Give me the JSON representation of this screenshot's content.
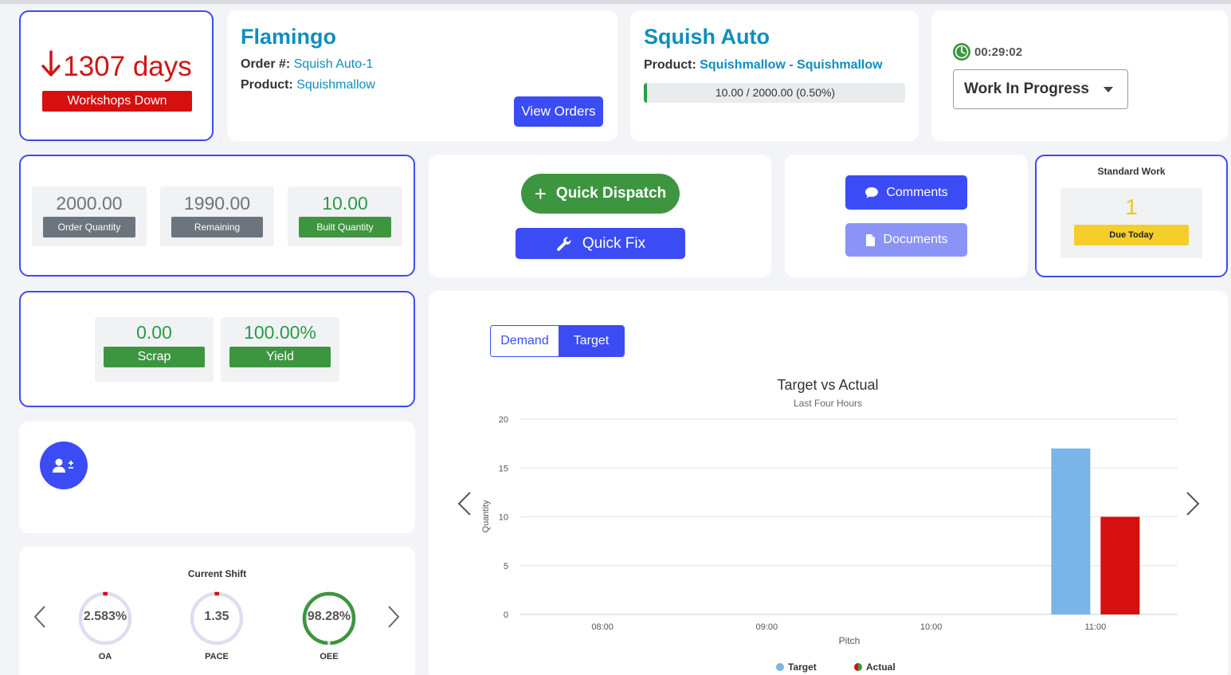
{
  "overdue": {
    "value": "1307 days",
    "badge": "Workshops Down"
  },
  "order": {
    "title": "Flamingo",
    "order_label": "Order #:",
    "order_value": "Squish Auto-1",
    "product_label": "Product:",
    "product_value": "Squishmallow",
    "view_orders": "View Orders"
  },
  "item": {
    "title": "Squish Auto",
    "product_label": "Product:",
    "product_value": "Squishmallow - Squishmallow",
    "progress_text": "10.00 / 2000.00 (0.50%)",
    "progress_fraction": 0.005
  },
  "timer": {
    "elapsed": "00:29:02",
    "status": "Work In Progress"
  },
  "quantities": [
    {
      "value": "2000.00",
      "label": "Order Quantity"
    },
    {
      "value": "1990.00",
      "label": "Remaining"
    },
    {
      "value": "10.00",
      "label": "Built Quantity"
    }
  ],
  "actions": {
    "quick_dispatch": "Quick Dispatch",
    "quick_fix": "Quick Fix",
    "comments": "Comments",
    "documents": "Documents"
  },
  "standard_work": {
    "title": "Standard Work",
    "value": "1",
    "badge": "Due Today"
  },
  "quality": [
    {
      "value": "0.00",
      "label": "Scrap"
    },
    {
      "value": "100.00%",
      "label": "Yield"
    }
  ],
  "shift": {
    "title": "Current Shift",
    "gauges": [
      {
        "value": "2.583%",
        "label": "OA",
        "fraction": 0.02583,
        "color": "#d60f0f"
      },
      {
        "value": "1.35",
        "label": "PACE",
        "fraction": 0.0135,
        "color": "#d60f0f"
      },
      {
        "value": "98.28%",
        "label": "OEE",
        "fraction": 0.9828,
        "color": "#3d963f"
      }
    ]
  },
  "chart_toggle": {
    "demand": "Demand",
    "target": "Target",
    "selected": "Target"
  },
  "colors": {
    "accent": "#3b4cf5",
    "danger": "#d60f0f",
    "success": "#3d963f",
    "brand_text": "#0d8fbf",
    "target_bar": "#7ab4e8",
    "actual_bar": "#d60f0f"
  },
  "chart_data": {
    "type": "bar",
    "title": "Target vs Actual",
    "subtitle": "Last Four Hours",
    "xlabel": "Pitch",
    "ylabel": "Quantity",
    "categories": [
      "08:00",
      "09:00",
      "10:00",
      "11:00"
    ],
    "ylim": [
      0,
      20
    ],
    "yticks": [
      0,
      5,
      10,
      15,
      20
    ],
    "grid": true,
    "legend": "bottom-center",
    "series": [
      {
        "name": "Target",
        "values": [
          0,
          0,
          0,
          17
        ]
      },
      {
        "name": "Actual",
        "values": [
          0,
          0,
          0,
          10
        ]
      }
    ]
  }
}
